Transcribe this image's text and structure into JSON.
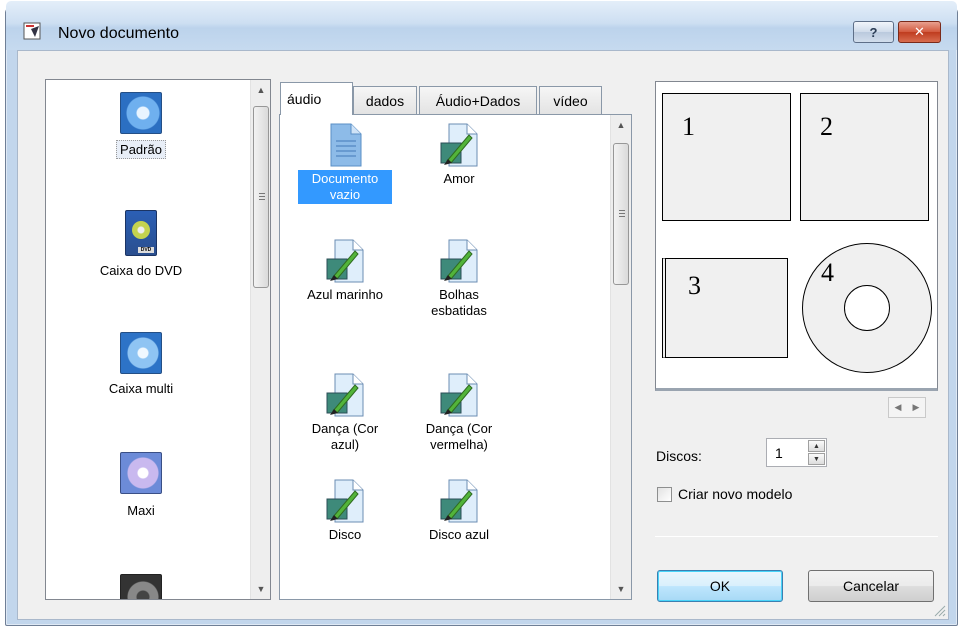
{
  "window": {
    "title": "Novo documento",
    "help_label": "?",
    "close_label": "✕"
  },
  "left_list": {
    "items": [
      {
        "label": "Padrão",
        "selected": true,
        "icon": "cd-case-icon"
      },
      {
        "label": "Caixa do DVD",
        "icon": "dvd-case-icon"
      },
      {
        "label": "Caixa multi",
        "icon": "multi-case-icon"
      },
      {
        "label": "Maxi",
        "icon": "maxi-case-icon"
      },
      {
        "label": "",
        "icon": "speaker-case-icon"
      }
    ]
  },
  "tabs": [
    {
      "label": "áudio",
      "active": true
    },
    {
      "label": "dados"
    },
    {
      "label": "Áudio+Dados"
    },
    {
      "label": "vídeo"
    }
  ],
  "templates": [
    {
      "label": "Documento vazio",
      "selected": true,
      "icon": "blank-document-icon"
    },
    {
      "label": "Amor",
      "icon": "paint-brush-template-icon"
    },
    {
      "label": "Azul marinho",
      "icon": "paint-brush-template-icon"
    },
    {
      "label": "Bolhas esbatidas",
      "icon": "paint-brush-template-icon"
    },
    {
      "label": "Dança (Cor azul)",
      "icon": "paint-brush-template-icon"
    },
    {
      "label": "Dança (Cor vermelha)",
      "icon": "paint-brush-template-icon"
    },
    {
      "label": "Disco",
      "icon": "paint-brush-template-icon"
    },
    {
      "label": "Disco azul",
      "icon": "paint-brush-template-icon"
    }
  ],
  "preview": {
    "labels": [
      "1",
      "2",
      "3",
      "4"
    ]
  },
  "discos": {
    "label": "Discos:",
    "value": "1"
  },
  "checkbox": {
    "label": "Criar novo modelo",
    "checked": false
  },
  "buttons": {
    "ok": "OK",
    "cancel": "Cancelar"
  }
}
